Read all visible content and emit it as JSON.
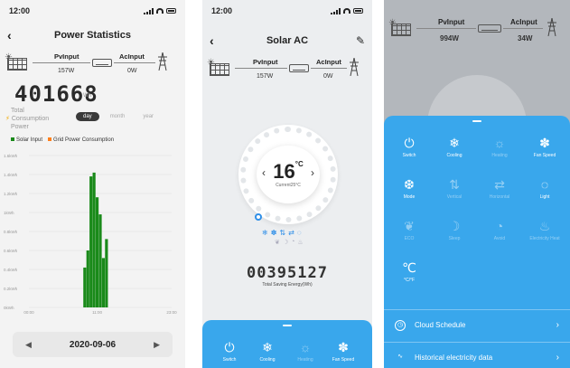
{
  "screen1": {
    "status_time": "12:00",
    "title": "Power Statistics",
    "pv_label": "PvInput",
    "pv_value": "157W",
    "ac_label": "AcInput",
    "ac_value": "0W",
    "total_value": "401668",
    "total_unit": "Wh",
    "total_label_1": "Total",
    "total_label_2": "Consumption",
    "total_label_3": "Power",
    "period_tabs": [
      "day",
      "month",
      "year"
    ],
    "period_selected": "day",
    "legend": [
      {
        "name": "Solar Input",
        "color": "#1a8a1a"
      },
      {
        "name": "Grid Power Consumption",
        "color": "#ff7f1a"
      }
    ],
    "date": "2020-09-06"
  },
  "chart_data": {
    "type": "bar",
    "x": [
      9.0,
      9.5,
      10.0,
      10.5,
      11.0,
      11.5,
      12.0,
      12.5
    ],
    "xlabel": "",
    "ylabel": "",
    "x_ticks": [
      "00:00",
      "11:00",
      "23:00"
    ],
    "x_tick_values": [
      0,
      11,
      23
    ],
    "xlim": [
      0,
      23
    ],
    "y_ticks": [
      "0kWh",
      "0.2kWh",
      "0.4kWh",
      "0.6kWh",
      "0.8kWh",
      "1kWh",
      "1.2kWh",
      "1.4kWh",
      "1.6kWh"
    ],
    "ylim": [
      0,
      1.6
    ],
    "series": [
      {
        "name": "Solar Input",
        "color": "#1a8a1a",
        "values": [
          0.42,
          0.6,
          1.38,
          1.42,
          1.16,
          0.98,
          0.52,
          0.72
        ]
      }
    ],
    "grid": "horizontal"
  },
  "screen2": {
    "status_time": "12:00",
    "title": "Solar AC",
    "pv_label": "PvInput",
    "pv_value": "157W",
    "ac_label": "AcInput",
    "ac_value": "0W",
    "set_temp": "16",
    "temp_unit": "°C",
    "current_temp": "Current25°C",
    "energy_value": "00395127",
    "energy_label": "Total Saving Energy(Wh)",
    "tiles": [
      {
        "label": "Switch",
        "icon": "power-icon",
        "glyph": "⏻",
        "active": true
      },
      {
        "label": "Cooling",
        "icon": "snowflake-icon",
        "glyph": "❄",
        "active": true
      },
      {
        "label": "Heating",
        "icon": "sun-icon",
        "glyph": "☼",
        "active": false
      },
      {
        "label": "Fan Speed",
        "icon": "fan-icon",
        "glyph": "✽",
        "active": true
      }
    ]
  },
  "screen3": {
    "pv_label": "PvInput",
    "pv_value": "994W",
    "ac_label": "AcInput",
    "ac_value": "34W",
    "tiles": [
      {
        "label": "Switch",
        "icon": "power-icon",
        "glyph": "⏻",
        "active": true
      },
      {
        "label": "Cooling",
        "icon": "snowflake-icon",
        "glyph": "❄",
        "active": true
      },
      {
        "label": "Heating",
        "icon": "sun-icon",
        "glyph": "☼",
        "active": false
      },
      {
        "label": "Fan Speed",
        "icon": "fan-icon",
        "glyph": "✽",
        "active": true
      },
      {
        "label": "Mode",
        "icon": "mode-icon",
        "glyph": "❆",
        "active": true
      },
      {
        "label": "Vertical",
        "icon": "vertical-swing-icon",
        "glyph": "⇅",
        "active": false
      },
      {
        "label": "Horizontal",
        "icon": "horizontal-swing-icon",
        "glyph": "⇄",
        "active": false
      },
      {
        "label": "Light",
        "icon": "bulb-icon",
        "glyph": "◌",
        "active": true
      },
      {
        "label": "ECO",
        "icon": "leaf-icon",
        "glyph": "❦",
        "active": false
      },
      {
        "label": "Sleep",
        "icon": "moon-icon",
        "glyph": "☽",
        "active": false
      },
      {
        "label": "Avoid",
        "icon": "avoid-icon",
        "glyph": "◔",
        "active": false
      },
      {
        "label": "Electricity Heat",
        "icon": "heat-icon",
        "glyph": "♨",
        "active": false
      },
      {
        "label": "°C/°F",
        "icon": "celsius-icon",
        "glyph": "℃",
        "active": true
      }
    ],
    "rows": [
      {
        "label": "Cloud Schedule",
        "icon": "clock-icon",
        "glyph": "◷"
      },
      {
        "label": "Historical electricity data",
        "icon": "pulse-icon",
        "glyph": "∿"
      }
    ]
  }
}
